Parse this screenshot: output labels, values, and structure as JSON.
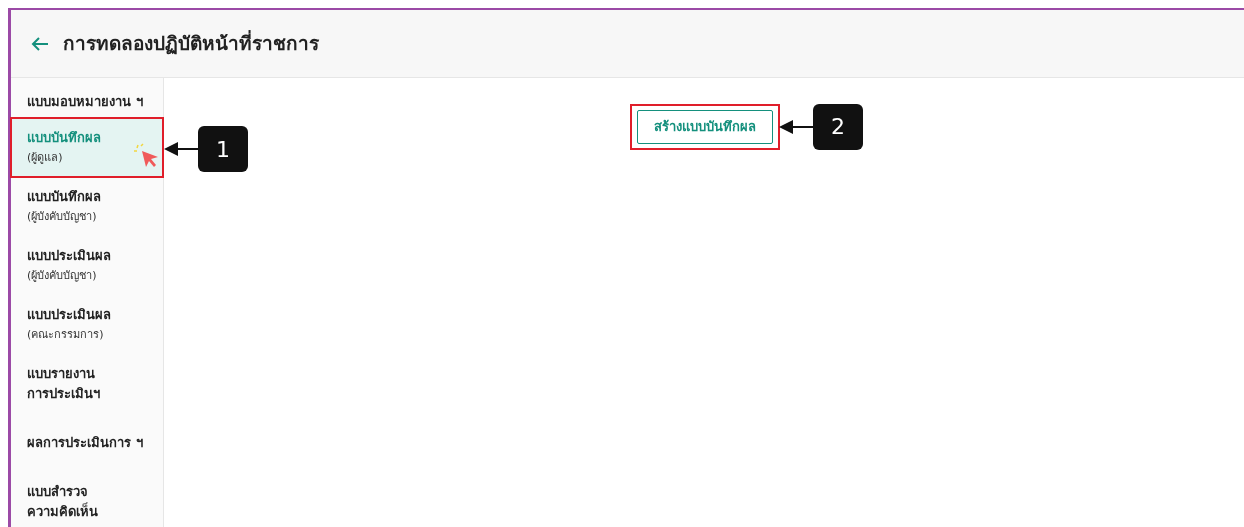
{
  "header": {
    "title": "การทดลองปฏิบัติหน้าที่ราชการ"
  },
  "sidebar": {
    "items": [
      {
        "label": "แบบมอบหมายงาน ฯ",
        "selected": false
      },
      {
        "label": "แบบบันทึกผล",
        "sublabel": "(ผู้ดูแล)",
        "selected": true,
        "highlighted": true,
        "callout": "1"
      },
      {
        "label": "แบบบันทึกผล",
        "sublabel": "(ผู้บังคับบัญชา)",
        "selected": false
      },
      {
        "label": "แบบประเมินผล",
        "sublabel": "(ผู้บังคับบัญชา)",
        "selected": false
      },
      {
        "label": "แบบประเมินผล",
        "sublabel": "(คณะกรรมการ)",
        "selected": false
      },
      {
        "label": "แบบรายงาน\nการประเมินฯ",
        "selected": false
      },
      {
        "label": "ผลการประเมินการ ฯ",
        "selected": false
      },
      {
        "label": "แบบสำรวจ\nความคิดเห็น",
        "selected": false
      }
    ]
  },
  "main": {
    "create_button": {
      "label": "สร้างแบบบันทึกผล",
      "highlighted": true,
      "callout": "2"
    }
  }
}
